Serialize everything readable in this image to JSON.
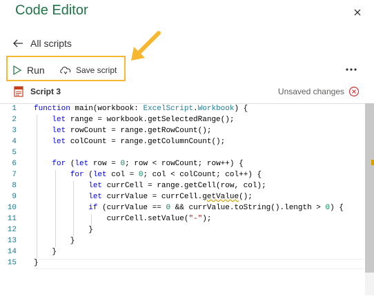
{
  "header": {
    "title": "Code Editor"
  },
  "nav": {
    "back_label": "All scripts"
  },
  "toolbar": {
    "run_label": "Run",
    "save_label": "Save script"
  },
  "script": {
    "name": "Script 3",
    "status": "Unsaved changes"
  },
  "editor": {
    "line_numbers": [
      "1",
      "2",
      "3",
      "4",
      "5",
      "6",
      "7",
      "8",
      "9",
      "10",
      "11",
      "12",
      "13",
      "14",
      "15"
    ]
  },
  "colors": {
    "accent": "#217346",
    "highlight": "#f7b731"
  }
}
